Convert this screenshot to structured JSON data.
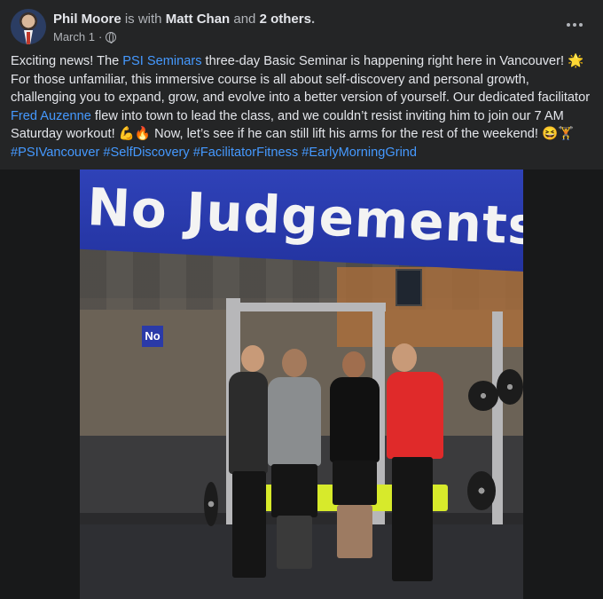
{
  "post": {
    "author": "Phil Moore",
    "with_text": "is with",
    "tagged_person": "Matt Chan",
    "and_text": "and",
    "others_text": "2 others",
    "period": ".",
    "date": "March 1",
    "date_separator": "·",
    "text": {
      "p1": "Exciting news! The ",
      "psi_link": "PSI Seminars",
      "p2": " three-day Basic Seminar is happening right here in Vancouver! 🌟 For those unfamiliar, this immersive course is all about self-discovery and personal growth, challenging you to expand, grow, and evolve into a better version of yourself.  Our dedicated facilitator ",
      "facilitator_link": "Fred Auzenne",
      "p3": " flew into town to lead the class, and we couldn’t resist inviting him to join our 7 AM Saturday workout! 💪🔥  Now, let’s see if he can still lift his arms for the rest of the weekend! 😆🏋️ ",
      "hashtags": [
        "#PSIVancouver",
        "#SelfDiscovery",
        "#FacilitatorFitness",
        "#EarlyMorningGrind"
      ]
    }
  },
  "photo": {
    "banner_text": "No Judgements",
    "small_sign": "No"
  },
  "icons": {
    "privacy": "globe-icon",
    "menu": "more-options-icon"
  },
  "colors": {
    "background": "#242526",
    "link": "#4599ff",
    "secondary_text": "#b0b3b8",
    "banner_blue": "#2333a0"
  }
}
